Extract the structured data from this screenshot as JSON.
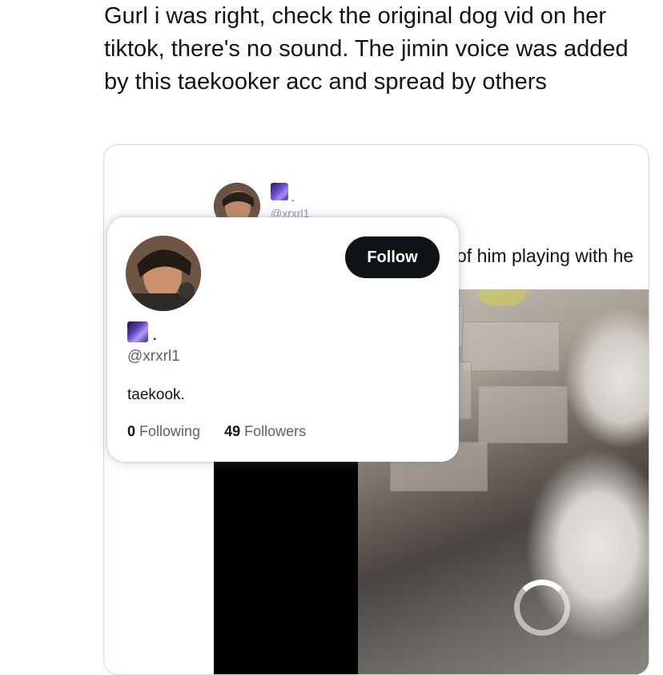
{
  "tweet": {
    "text": "Gurl i was right, check the original dog vid on her tiktok, there's no sound. The jimin voice was added by this taekooker acc and spread by others"
  },
  "embedded_tweet": {
    "handle": "@xrxrl1",
    "badge_suffix": ".",
    "text_fragment": "of him playing with he"
  },
  "profile_popup": {
    "follow_label": "Follow",
    "badge_suffix": ".",
    "handle": "@xrxrl1",
    "bio": "taekook.",
    "following_count": "0",
    "following_label": "Following",
    "followers_count": "49",
    "followers_label": "Followers"
  },
  "video": {
    "state": "loading"
  },
  "colors": {
    "text_primary": "#0f1419",
    "text_secondary": "#536471",
    "follow_button_bg": "#0f1419",
    "card_border": "#cfd9de"
  },
  "icons": {
    "avatar": "profile-photo",
    "badge": "purple-galaxy-emoji",
    "spinner": "loading-spinner-icon"
  }
}
